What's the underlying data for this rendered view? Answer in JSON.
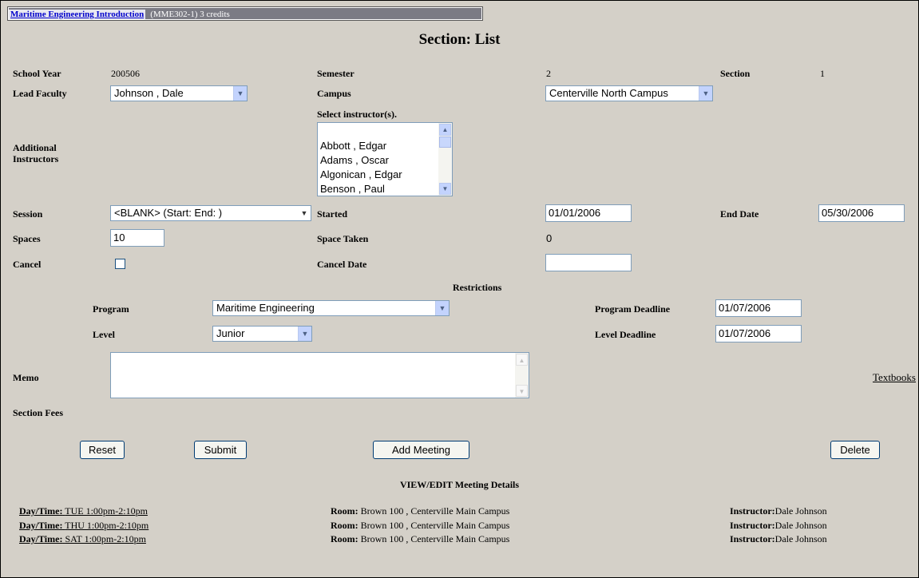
{
  "course": {
    "name": "Maritime Engineering Introduction",
    "meta": "(MME302-1) 3 credits"
  },
  "page_title": "Section: List",
  "fields": {
    "school_year_label": "School Year",
    "school_year_value": "200506",
    "semester_label": "Semester",
    "semester_value": "2",
    "section_label": "Section",
    "section_value": "1",
    "lead_faculty_label": "Lead Faculty",
    "lead_faculty_value": "Johnson , Dale",
    "campus_label": "Campus",
    "campus_value": "Centerville North Campus",
    "select_instructors_label": "Select instructor(s).",
    "additional_instructors_label_1": "Additional",
    "additional_instructors_label_2": "Instructors",
    "instructors": [
      "Abbott , Edgar",
      "Adams , Oscar",
      "Algonican , Edgar",
      "Benson , Paul"
    ],
    "session_label": "Session",
    "session_value": "<BLANK> (Start: End: )",
    "started_label": "Started",
    "started_value": "01/01/2006",
    "end_date_label": "End Date",
    "end_date_value": "05/30/2006",
    "spaces_label": "Spaces",
    "spaces_value": "10",
    "space_taken_label": "Space Taken",
    "space_taken_value": "0",
    "cancel_label": "Cancel",
    "cancel_checked": false,
    "cancel_date_label": "Cancel Date",
    "cancel_date_value": ""
  },
  "restrictions": {
    "heading": "Restrictions",
    "program_label": "Program",
    "program_value": "Maritime Engineering",
    "program_deadline_label": "Program Deadline",
    "program_deadline_value": "01/07/2006",
    "level_label": "Level",
    "level_value": "Junior",
    "level_deadline_label": "Level Deadline",
    "level_deadline_value": "01/07/2006"
  },
  "memo_label": "Memo",
  "textbooks_link": "Textbooks",
  "section_fees_label": "Section Fees",
  "buttons": {
    "reset": "Reset",
    "submit": "Submit",
    "add_meeting": "Add Meeting",
    "delete": "Delete"
  },
  "meetings": {
    "heading": "VIEW/EDIT Meeting Details",
    "daytime_label": "Day/Time:",
    "room_label": "Room:",
    "instructor_label": "Instructor:",
    "rows": [
      {
        "daytime": "TUE 1:00pm-2:10pm",
        "room": "Brown 100 , Centerville Main Campus",
        "instructor": "Dale Johnson"
      },
      {
        "daytime": "THU 1:00pm-2:10pm",
        "room": "Brown 100 , Centerville Main Campus",
        "instructor": "Dale Johnson"
      },
      {
        "daytime": "SAT 1:00pm-2:10pm",
        "room": "Brown 100 , Centerville Main Campus",
        "instructor": "Dale Johnson"
      }
    ]
  }
}
